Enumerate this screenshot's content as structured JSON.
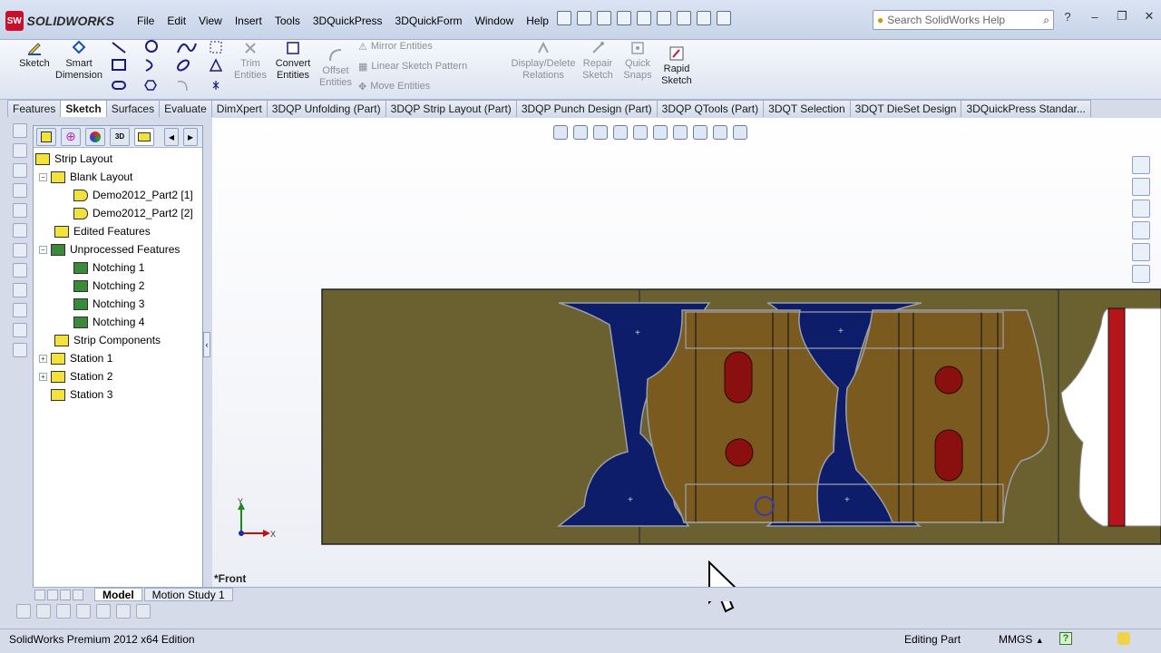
{
  "app": {
    "name": "SOLIDWORKS",
    "logo_badge": "SW"
  },
  "menu": [
    "File",
    "Edit",
    "View",
    "Insert",
    "Tools",
    "3DQuickPress",
    "3DQuickForm",
    "Window",
    "Help"
  ],
  "search": {
    "placeholder": "Search SolidWorks Help"
  },
  "ribbon": {
    "sketch": "Sketch",
    "smart_dimension_1": "Smart",
    "smart_dimension_2": "Dimension",
    "trim_1": "Trim",
    "trim_2": "Entities",
    "convert_1": "Convert",
    "convert_2": "Entities",
    "offset_1": "Offset",
    "offset_2": "Entities",
    "mirror": "Mirror Entities",
    "linear_pattern": "Linear Sketch Pattern",
    "move": "Move Entities",
    "display_delete_1": "Display/Delete",
    "display_delete_2": "Relations",
    "repair_1": "Repair",
    "repair_2": "Sketch",
    "quick_1": "Quick",
    "quick_2": "Snaps",
    "rapid_1": "Rapid",
    "rapid_2": "Sketch"
  },
  "command_tabs": [
    "Features",
    "Sketch",
    "Surfaces",
    "Evaluate",
    "DimXpert",
    "3DQP Unfolding (Part)",
    "3DQP Strip Layout (Part)",
    "3DQP Punch Design (Part)",
    "3DQP QTools (Part)",
    "3DQT Selection",
    "3DQT DieSet Design",
    "3DQuickPress Standar..."
  ],
  "active_tab": "Sketch",
  "tree": {
    "root": "Strip Layout",
    "blank_layout": "Blank Layout",
    "part1": "Demo2012_Part2 [1]",
    "part2": "Demo2012_Part2 [2]",
    "edited": "Edited Features",
    "unprocessed": "Unprocessed Features",
    "notch1": "Notching 1",
    "notch2": "Notching 2",
    "notch3": "Notching 3",
    "notch4": "Notching 4",
    "strip_components": "Strip Components",
    "station1": "Station 1",
    "station2": "Station 2",
    "station3": "Station 3"
  },
  "view_label": "*Front",
  "triad": {
    "y": "Y",
    "x": "X"
  },
  "bottom_tabs": {
    "model": "Model",
    "motion": "Motion Study 1"
  },
  "status": {
    "edition": "SolidWorks Premium 2012 x64 Edition",
    "mode": "Editing Part",
    "units": "MMGS",
    "units_arrow": "▲",
    "help": "?"
  },
  "colors": {
    "strip": "#6b6030",
    "blank_punched": "#0d1d6a",
    "part": "#7a5a1e",
    "hole": "#8a0f0f",
    "accent_red": "#b4161c"
  }
}
